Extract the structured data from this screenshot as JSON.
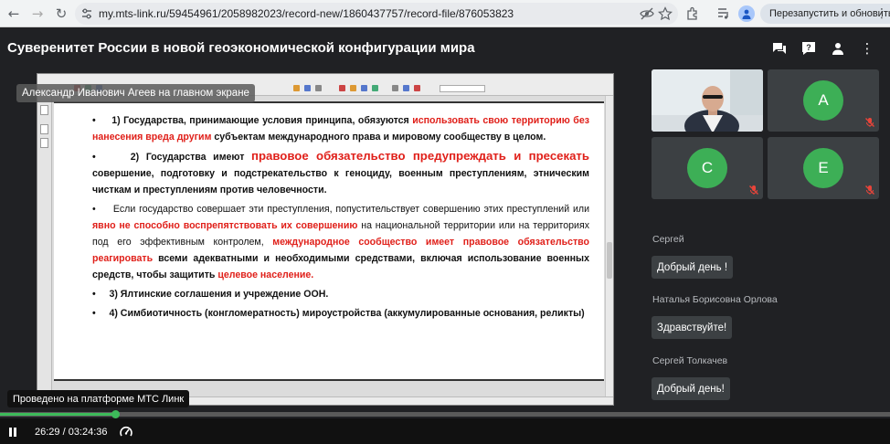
{
  "browser": {
    "url": "my.mts-link.ru/59454961/2058982023/record-new/1860437757/record-file/876053823",
    "relaunch_label": "Перезапустить и обновить"
  },
  "app": {
    "title": "Суверенитет России в новой геоэкономической конфигурации мира"
  },
  "share": {
    "presenter_label": "Александр Иванович Агеев на главном экране",
    "document": {
      "p1": {
        "a": "1) Государства, принимающие условия принципа, обязуются ",
        "b": "использовать свою территорию без нанесения вреда другим",
        "c": " субъектам международного права и мировому сообществу в целом."
      },
      "p2": {
        "a": "2) Государства имеют ",
        "b": "правовое обязательство предупреждать и пресекать",
        "c": " совершение, подготовку и подстрекательство к геноциду, военным преступлениям, этническим чисткам и преступлениям против человечности."
      },
      "p3": {
        "a": "Если государство совершает эти преступления, попустительствует совершению этих преступлений или ",
        "b": "явно не способно воспрепятствовать их совершению",
        "c": " на национальной территории или на территориях под его эффективным контролем, ",
        "d": "международное сообщество имеет правовое обязательство реагировать",
        "e": " всеми адекватными и необходимыми средствами, включая использование военных средств, чтобы защитить ",
        "f": "целевое население."
      },
      "p4": "3) Ялтинские соглашения и учреждение ООН.",
      "p5": "4) Симбиотичность (конгломератность) мироустройства (аккумулированные основания, реликты)"
    }
  },
  "participants": [
    {
      "type": "video"
    },
    {
      "initial": "А",
      "muted": true
    },
    {
      "initial": "С",
      "muted": true
    },
    {
      "initial": "Е",
      "muted": true
    }
  ],
  "chat": [
    {
      "author": "Сергей",
      "text": "Добрый день !"
    },
    {
      "author": "Наталья Борисовна Орлова",
      "text": "Здравствуйте!"
    },
    {
      "author": "Сергей Толкачев",
      "text": "Добрый день!"
    }
  ],
  "player": {
    "platform_label": "Проведено на платформе МТС Линк",
    "time_label": "26:29 / 03:24:36",
    "progress": 0.1297
  },
  "colors": {
    "accent_green": "#3daf56",
    "highlight_red": "#e0201a",
    "background": "#202124"
  }
}
